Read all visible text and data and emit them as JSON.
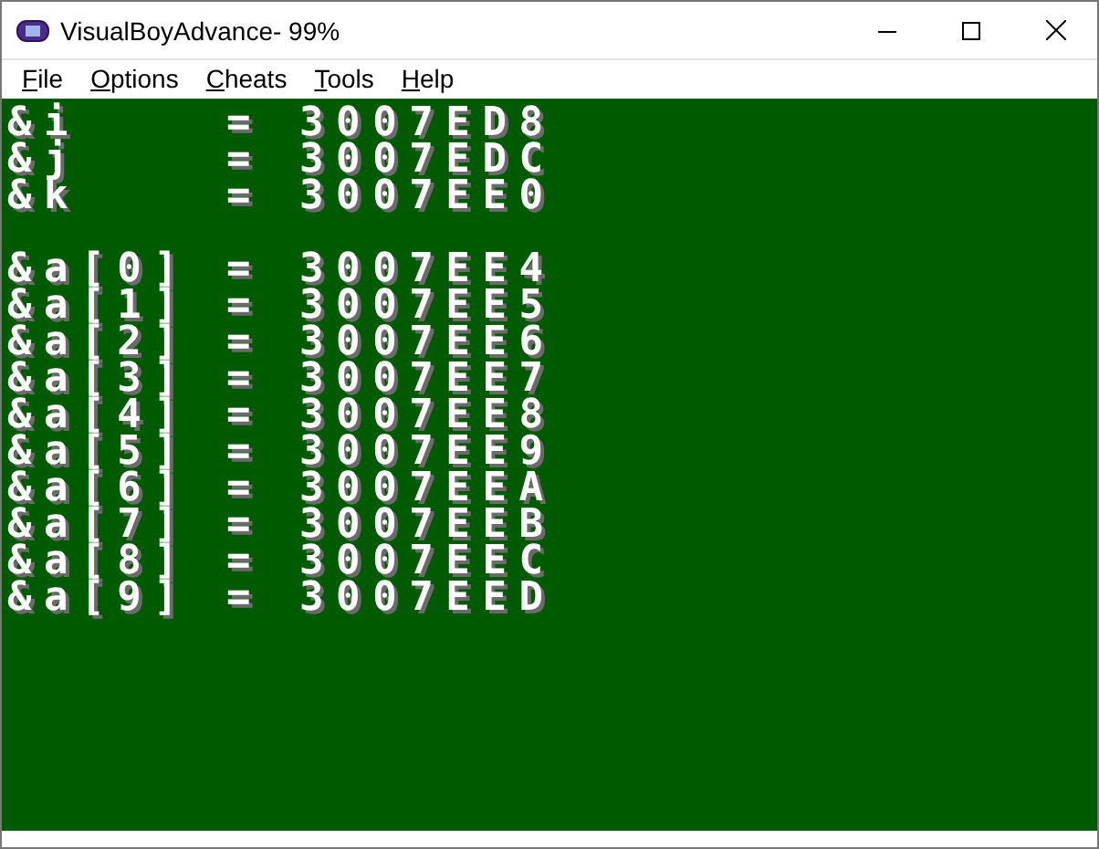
{
  "window": {
    "title": "VisualBoyAdvance- 99%"
  },
  "menu": [
    {
      "label": "File"
    },
    {
      "label": "Options"
    },
    {
      "label": "Cheats"
    },
    {
      "label": "Tools"
    },
    {
      "label": "Help"
    }
  ],
  "screen": {
    "groups": [
      {
        "rows": [
          {
            "name": "&i",
            "sign": "=",
            "value": "3007ED8"
          },
          {
            "name": "&j",
            "sign": "=",
            "value": "3007EDC"
          },
          {
            "name": "&k",
            "sign": "=",
            "value": "3007EE0"
          }
        ]
      },
      {
        "rows": [
          {
            "name": "&a[0]",
            "sign": "=",
            "value": "3007EE4"
          },
          {
            "name": "&a[1]",
            "sign": "=",
            "value": "3007EE5"
          },
          {
            "name": "&a[2]",
            "sign": "=",
            "value": "3007EE6"
          },
          {
            "name": "&a[3]",
            "sign": "=",
            "value": "3007EE7"
          },
          {
            "name": "&a[4]",
            "sign": "=",
            "value": "3007EE8"
          },
          {
            "name": "&a[5]",
            "sign": "=",
            "value": "3007EE9"
          },
          {
            "name": "&a[6]",
            "sign": "=",
            "value": "3007EEA"
          },
          {
            "name": "&a[7]",
            "sign": "=",
            "value": "3007EEB"
          },
          {
            "name": "&a[8]",
            "sign": "=",
            "value": "3007EEC"
          },
          {
            "name": "&a[9]",
            "sign": "=",
            "value": "3007EED"
          }
        ]
      }
    ]
  }
}
